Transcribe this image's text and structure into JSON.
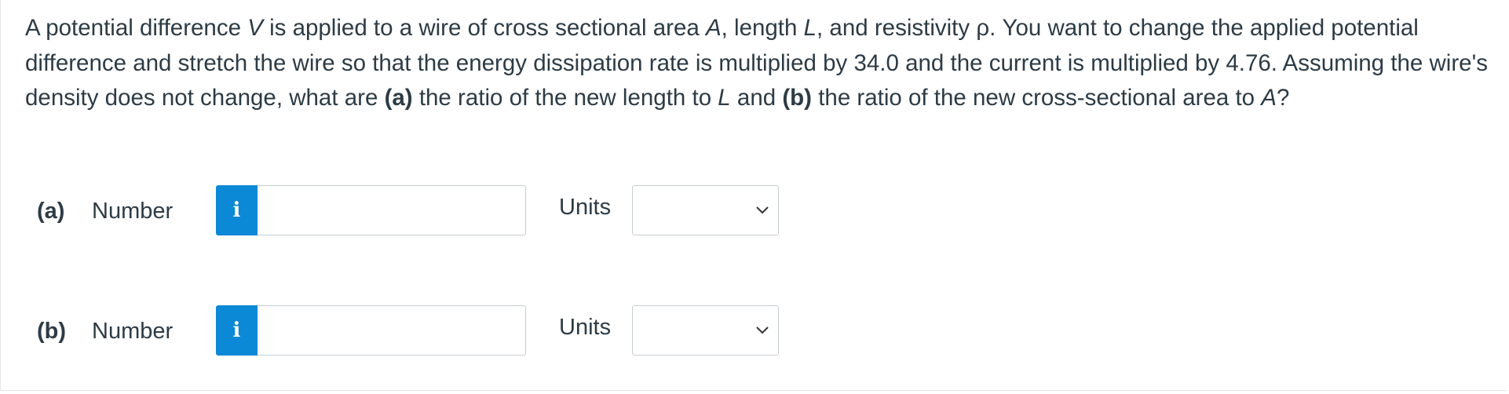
{
  "question": {
    "s1": "A potential difference ",
    "V": "V",
    "s2": " is applied to a wire of cross sectional area ",
    "A1": "A",
    "s3": ", length ",
    "L1": "L",
    "s4": ", and resistivity ρ. You want to change the applied potential difference and stretch the wire so that the energy dissipation rate is multiplied by 34.0 and the current is multiplied by 4.76. Assuming the wire's density does not change, what are ",
    "a": "(a)",
    "s5": " the ratio of the new length to ",
    "L2": "L",
    "s6": " and ",
    "b": "(b)",
    "s7": " the ratio of the new cross-sectional area to ",
    "A2": "A",
    "s8": "?"
  },
  "parts": [
    {
      "label": "(a)",
      "number_label": "Number",
      "info_icon": "i",
      "value": "",
      "units_label": "Units",
      "units_value": ""
    },
    {
      "label": "(b)",
      "number_label": "Number",
      "info_icon": "i",
      "value": "",
      "units_label": "Units",
      "units_value": ""
    }
  ],
  "colors": {
    "accent": "#0b88d6",
    "text": "#2d3b45",
    "border": "#c7cdd1"
  }
}
